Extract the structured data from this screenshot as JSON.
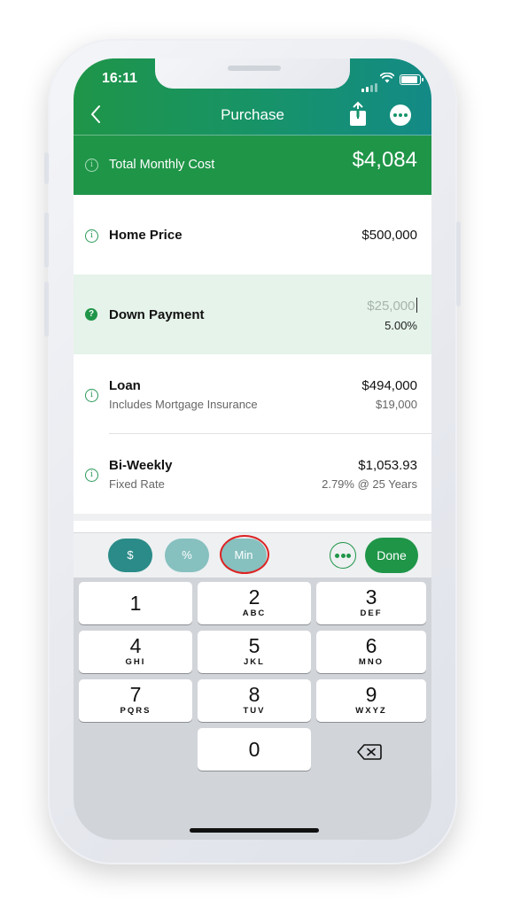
{
  "status": {
    "time": "16:11"
  },
  "nav": {
    "title": "Purchase"
  },
  "summary": {
    "label": "Total Monthly Cost",
    "value": "$4,084"
  },
  "rows": {
    "home_price": {
      "label": "Home Price",
      "value": "$500,000"
    },
    "down_payment": {
      "label": "Down Payment",
      "placeholder": "$25,000",
      "percent": "5.00%"
    },
    "loan": {
      "label": "Loan",
      "sub": "Includes Mortgage Insurance",
      "value": "$494,000",
      "sub_value": "$19,000"
    },
    "biweekly": {
      "label": "Bi-Weekly",
      "sub": "Fixed Rate",
      "value": "$1,053.93",
      "sub_value": "2.79% @ 25 Years"
    }
  },
  "accessory": {
    "dollar": "$",
    "percent": "%",
    "min": "Min",
    "done": "Done"
  },
  "keypad": [
    {
      "num": "1",
      "letters": ""
    },
    {
      "num": "2",
      "letters": "ABC"
    },
    {
      "num": "3",
      "letters": "DEF"
    },
    {
      "num": "4",
      "letters": "GHI"
    },
    {
      "num": "5",
      "letters": "JKL"
    },
    {
      "num": "6",
      "letters": "MNO"
    },
    {
      "num": "7",
      "letters": "PQRS"
    },
    {
      "num": "8",
      "letters": "TUV"
    },
    {
      "num": "9",
      "letters": "WXYZ"
    },
    {
      "num": "0",
      "letters": ""
    }
  ],
  "colors": {
    "brand_green": "#1f9548",
    "teal": "#138a86",
    "highlight": "#d22222"
  },
  "icons": [
    "back-chevron-icon",
    "share-icon",
    "more-icon",
    "info-icon",
    "help-icon",
    "dots-icon",
    "delete-icon"
  ]
}
